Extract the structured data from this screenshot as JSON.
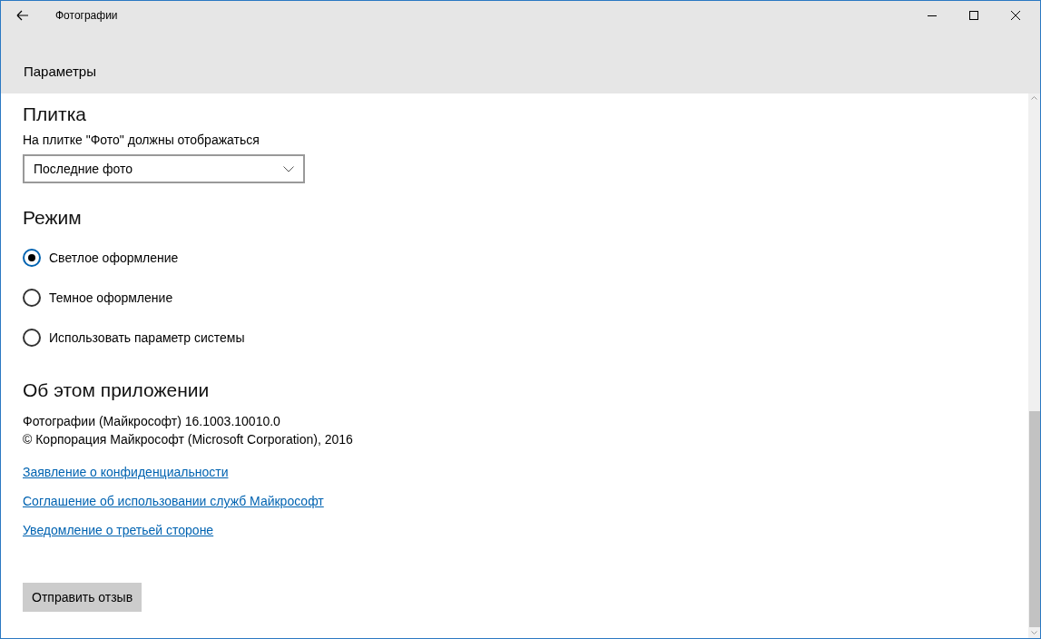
{
  "window": {
    "title": "Фотографии"
  },
  "header": {
    "title": "Параметры"
  },
  "tile_section": {
    "heading": "Плитка",
    "label": "На плитке \"Фото\" должны отображаться",
    "dropdown": {
      "value": "Последние фото"
    }
  },
  "mode_section": {
    "heading": "Режим",
    "options": [
      {
        "label": "Светлое оформление",
        "selected": true
      },
      {
        "label": "Темное оформление",
        "selected": false
      },
      {
        "label": "Использовать параметр системы",
        "selected": false
      }
    ]
  },
  "about_section": {
    "heading": "Об этом приложении",
    "lines": [
      "Фотографии (Майкрософт) 16.1003.10010.0",
      "© Корпорация Майкрософт (Microsoft Corporation), 2016"
    ],
    "links": [
      "Заявление о конфиденциальности",
      "Соглашение об использовании служб Майкрософт",
      "Уведомление о третьей стороне"
    ]
  },
  "feedback_button": {
    "label": "Отправить отзыв"
  }
}
